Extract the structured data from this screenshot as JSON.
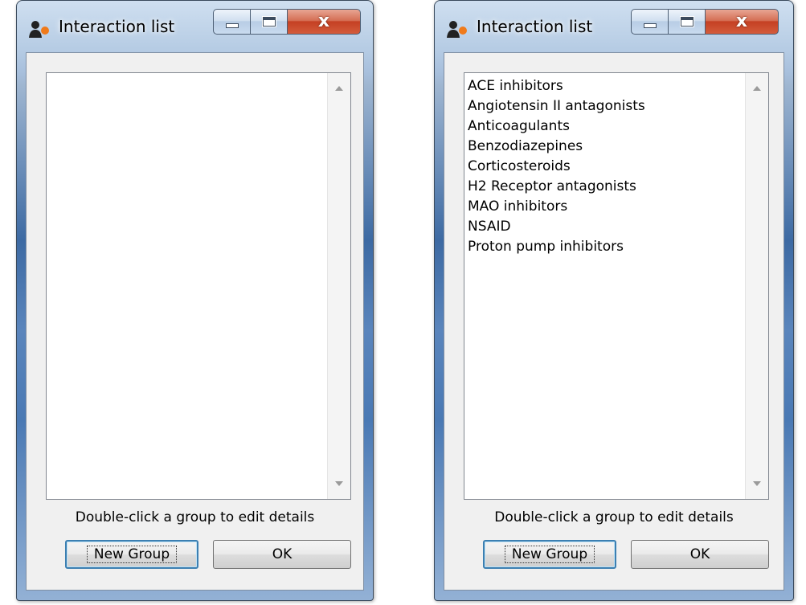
{
  "windows": [
    {
      "title": "Interaction list",
      "items": [],
      "hint": "Double-click a group to edit details",
      "new_group_label": "New Group",
      "ok_label": "OK",
      "close_glyph": "x"
    },
    {
      "title": "Interaction list",
      "items": [
        "ACE inhibitors",
        "Angiotensin II antagonists",
        "Anticoagulants",
        "Benzodiazepines",
        "Corticosteroids",
        "H2 Receptor antagonists",
        "MAO inhibitors",
        "NSAID",
        "Proton pump inhibitors"
      ],
      "hint": "Double-click a group to edit details",
      "new_group_label": "New Group",
      "ok_label": "OK",
      "close_glyph": "x"
    }
  ],
  "icons": {
    "app": "people-icon",
    "minimize": "minimize-icon",
    "maximize": "maximize-icon",
    "close": "close-icon",
    "scroll_up": "scroll-up-arrow-icon",
    "scroll_down": "scroll-down-arrow-icon"
  },
  "colors": {
    "titlebar": "#a7bfdc",
    "close_button": "#c44023",
    "focus_ring": "#3c7fb1",
    "dialog_bg": "#f0f0f0"
  }
}
